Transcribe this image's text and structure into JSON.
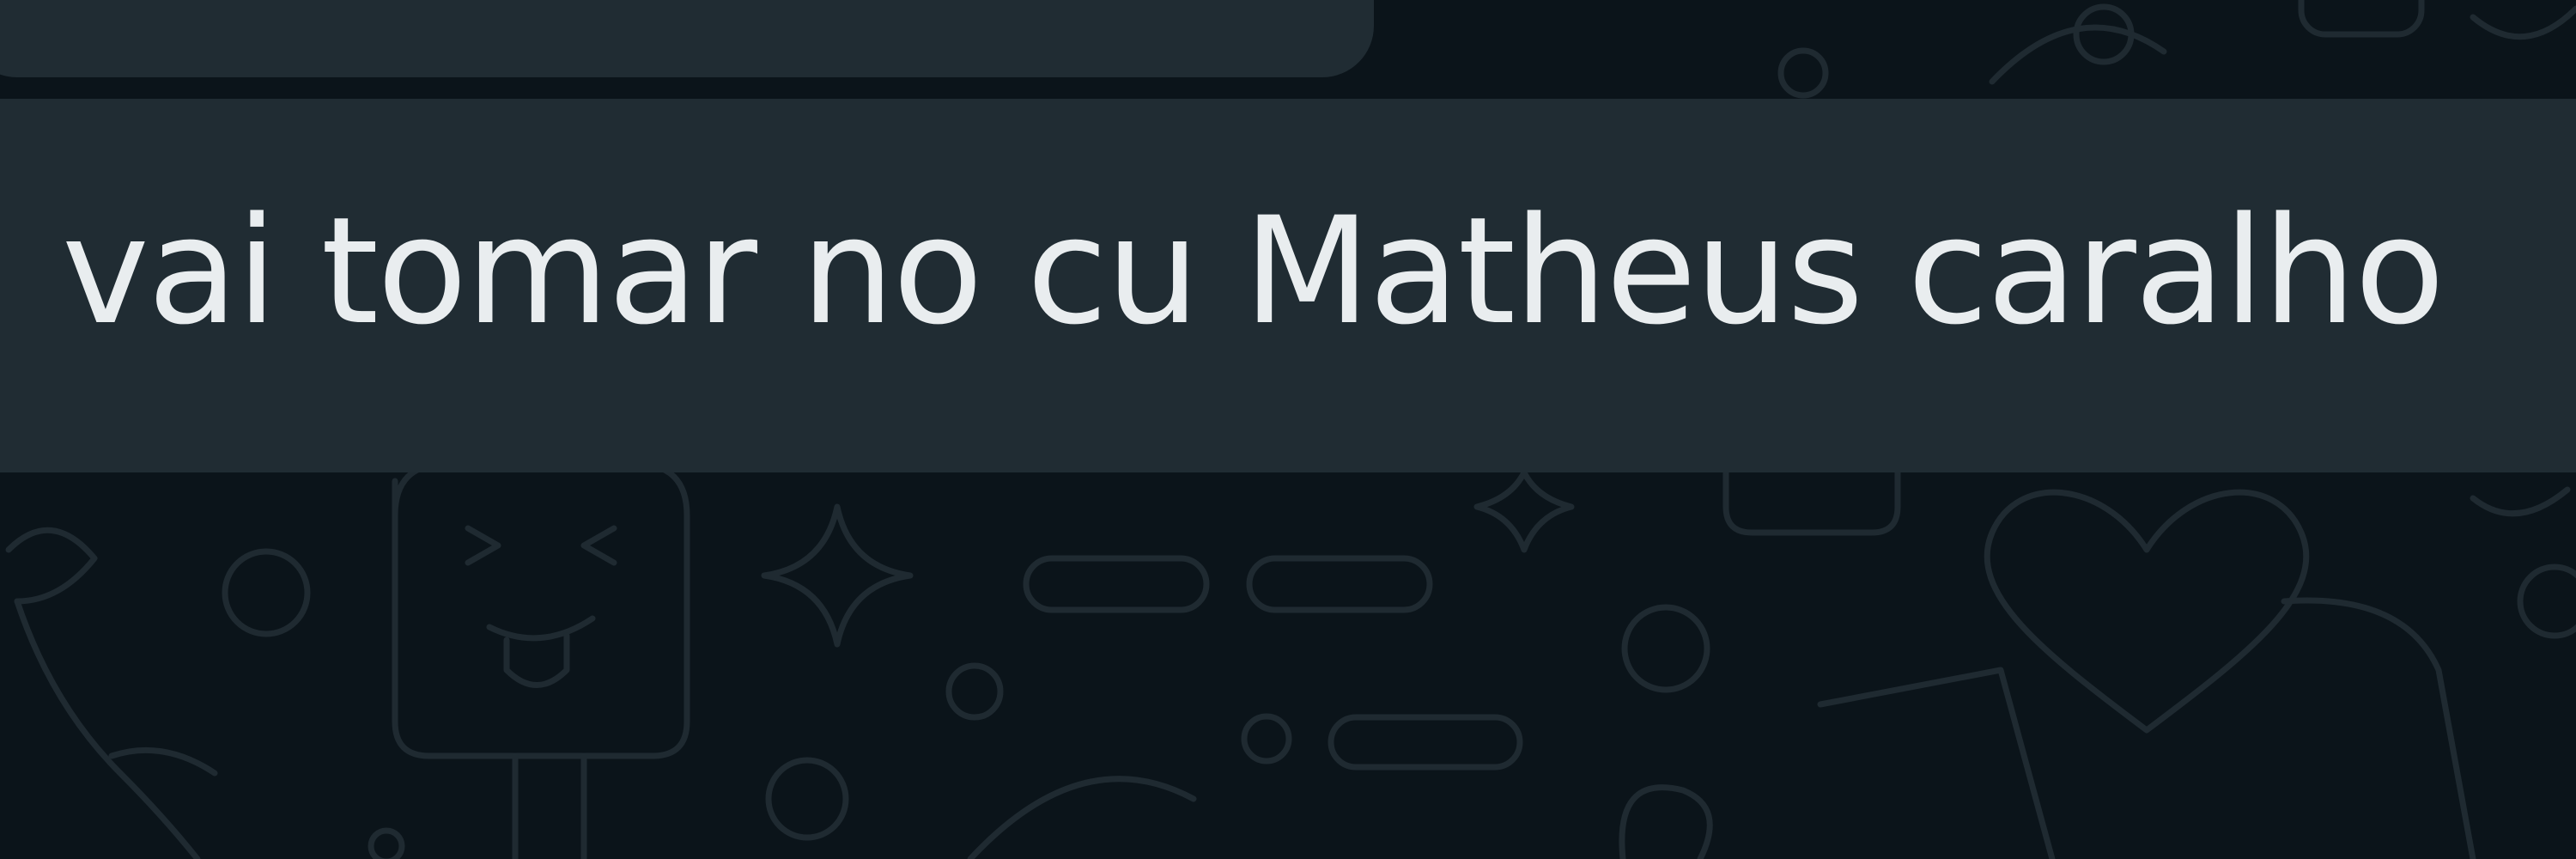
{
  "conversation": {
    "messages": [
      {
        "text": ""
      },
      {
        "text": "vai tomar no cu Matheus caralho"
      }
    ]
  },
  "colors": {
    "wallpaper_background": "#0b141a",
    "wallpaper_doodle": "#1f2a31",
    "bubble_background": "#202c33",
    "message_text": "#e9edef"
  }
}
